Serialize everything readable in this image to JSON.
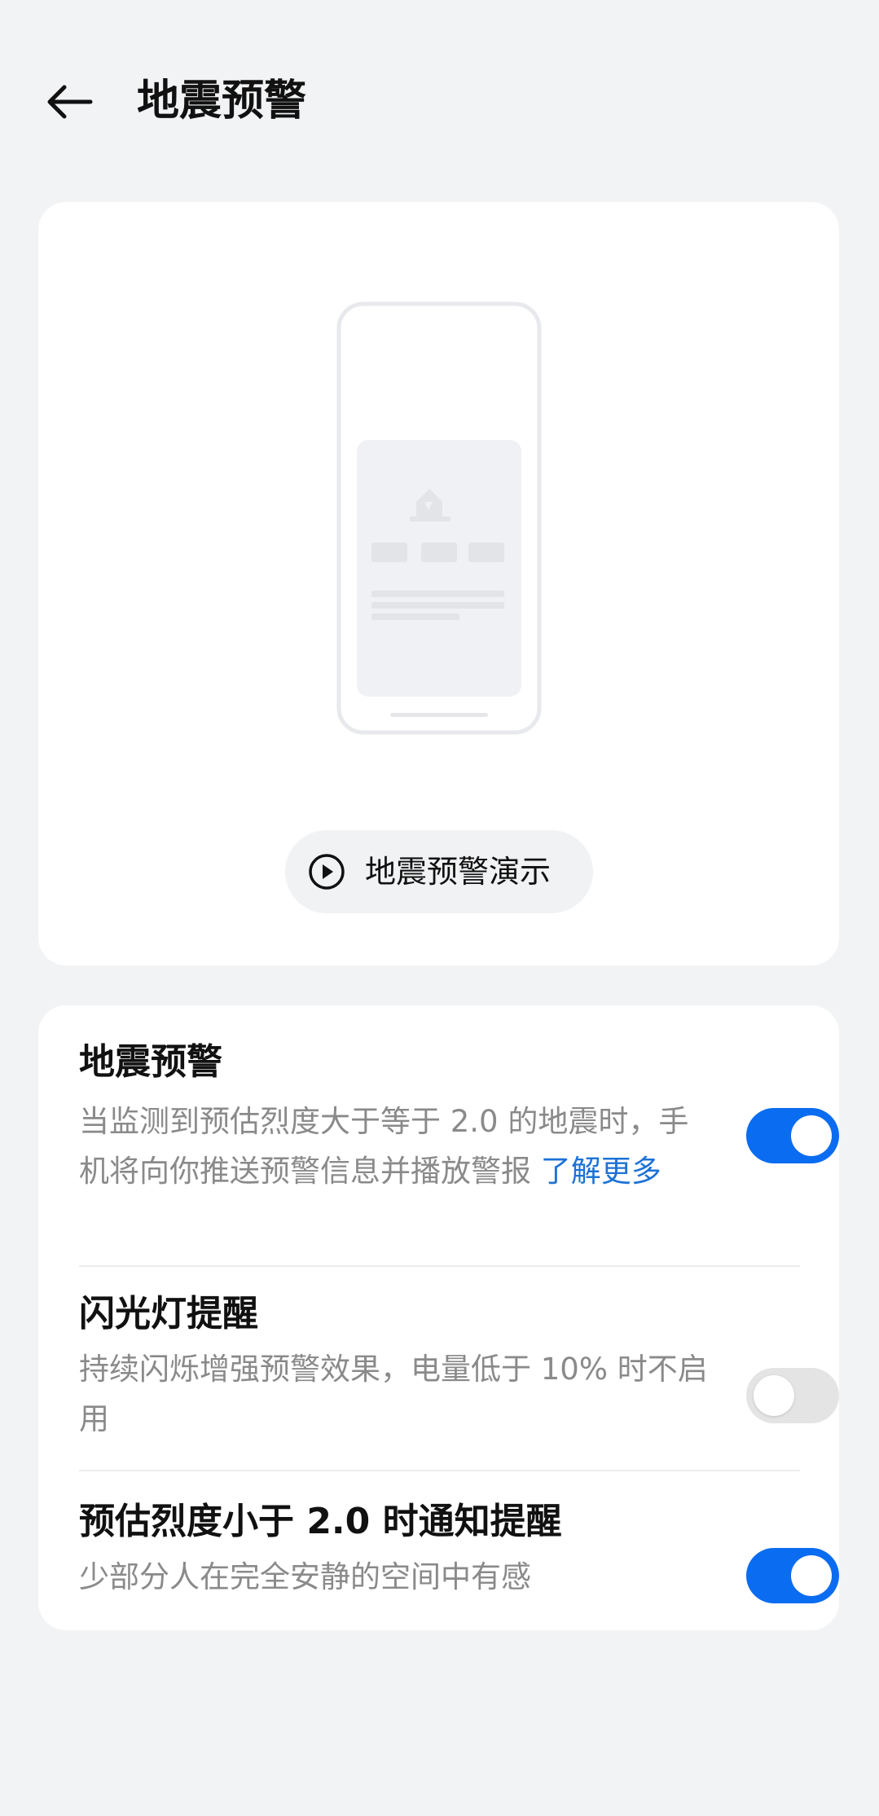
{
  "header": {
    "title": "地震预警",
    "back_icon": "arrow-left-icon"
  },
  "demo": {
    "illustration_icon": "phone-alert-illustration",
    "play_icon": "play-circle-icon",
    "button_label": "地震预警演示"
  },
  "settings": [
    {
      "title": "地震预警",
      "description": "当监测到预估烈度大于等于 2.0 的地震时，手机将向你推送预警信息并播放警报",
      "link": "了解更多",
      "enabled": true
    },
    {
      "title": "闪光灯提醒",
      "description": "持续闪烁增强预警效果，电量低于 10% 时不启用",
      "enabled": false
    },
    {
      "title": "预估烈度小于 2.0 时通知提醒",
      "description": "少部分人在完全安静的空间中有感",
      "enabled": true
    }
  ],
  "colors": {
    "accent": "#0a6cf0",
    "link": "#1d72d6",
    "background": "#f1f3f5",
    "card": "#ffffff"
  }
}
